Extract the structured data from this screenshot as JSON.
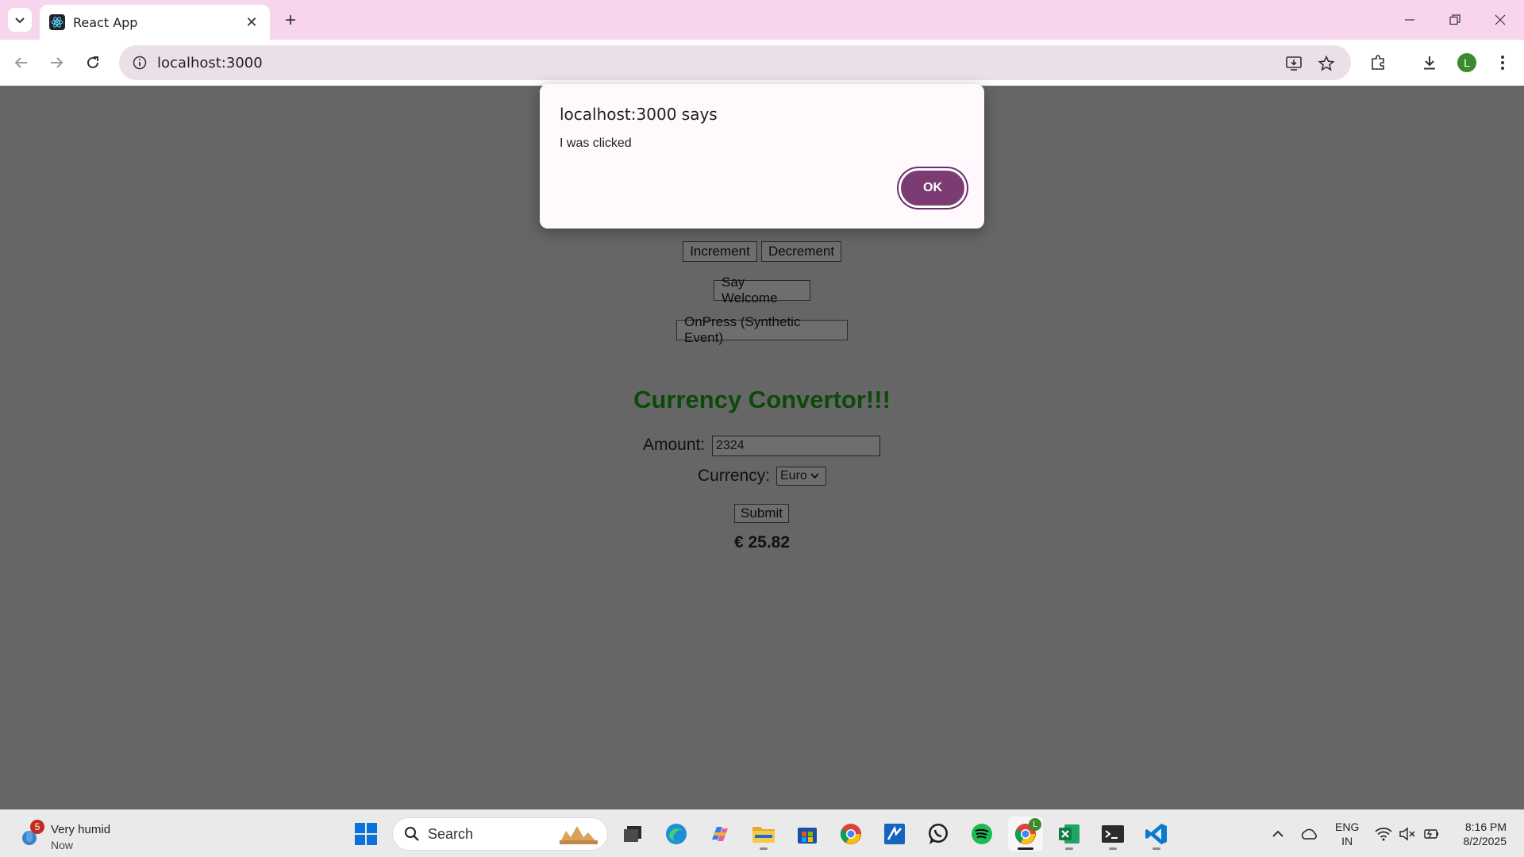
{
  "browser": {
    "tab_title": "React App",
    "url": "localhost:3000"
  },
  "profile_initial": "L",
  "page": {
    "buttons": {
      "increment": "Increment",
      "decrement": "Decrement",
      "say_welcome": "Say Welcome",
      "onpress": "OnPress (Synthetic Event)"
    },
    "converter": {
      "title": "Currency Convertor!!!",
      "amount_label": "Amount:",
      "amount_value": "2324",
      "currency_label": "Currency:",
      "currency_selected": "Euro",
      "submit_label": "Submit",
      "result": "€ 25.82"
    }
  },
  "dialog": {
    "title": "localhost:3000 says",
    "message": "I was clicked",
    "ok_label": "OK"
  },
  "taskbar": {
    "weather_badge": "5",
    "weather_condition": "Very humid",
    "weather_time": "Now",
    "search_label": "Search",
    "language_line1": "ENG",
    "language_line2": "IN",
    "time": "8:16 PM",
    "date": "8/2/2025",
    "chrome_badge": "L"
  },
  "colors": {
    "page_bg": "#666666",
    "title_green": "#0b4a0b",
    "dialog_ok": "#7a3c73",
    "tabstrip": "#f7d5ec"
  }
}
